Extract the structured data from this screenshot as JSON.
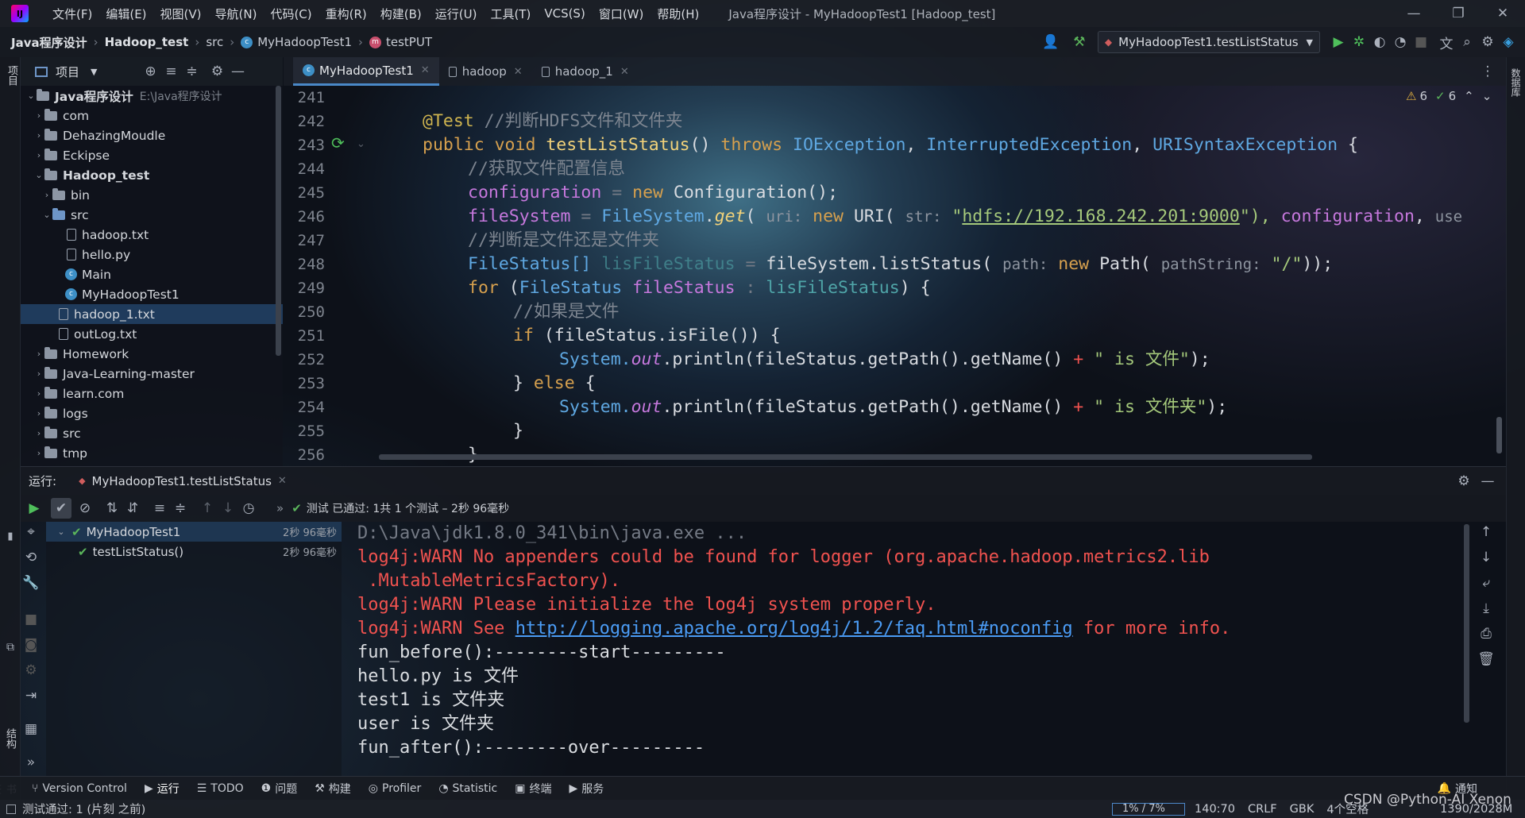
{
  "title_bar": {
    "menus": [
      "文件(F)",
      "编辑(E)",
      "视图(V)",
      "导航(N)",
      "代码(C)",
      "重构(R)",
      "构建(B)",
      "运行(U)",
      "工具(T)",
      "VCS(S)",
      "窗口(W)",
      "帮助(H)"
    ],
    "window_title": "Java程序设计 - MyHadoopTest1 [Hadoop_test]"
  },
  "breadcrumb": {
    "items": [
      "Java程序设计",
      "Hadoop_test",
      "src",
      "MyHadoopTest1",
      "testPUT"
    ]
  },
  "run_config": "MyHadoopTest1.testListStatus",
  "project_panel": {
    "title": "项目",
    "tree": [
      {
        "label": "Java程序设计",
        "path": "E:\\Java程序设计",
        "kind": "root"
      },
      {
        "label": "com",
        "kind": "folder"
      },
      {
        "label": "DehazingMoudle",
        "kind": "folder"
      },
      {
        "label": "Eckipse",
        "kind": "folder"
      },
      {
        "label": "Hadoop_test",
        "kind": "folder"
      },
      {
        "label": "bin",
        "kind": "folder"
      },
      {
        "label": "src",
        "kind": "folder"
      },
      {
        "label": "hadoop.txt",
        "kind": "file"
      },
      {
        "label": "hello.py",
        "kind": "file"
      },
      {
        "label": "Main",
        "kind": "class"
      },
      {
        "label": "MyHadoopTest1",
        "kind": "class"
      },
      {
        "label": "hadoop_1.txt",
        "kind": "file"
      },
      {
        "label": "outLog.txt",
        "kind": "file"
      },
      {
        "label": "Homework",
        "kind": "folder"
      },
      {
        "label": "Java-Learning-master",
        "kind": "folder"
      },
      {
        "label": "learn.com",
        "kind": "folder"
      },
      {
        "label": "logs",
        "kind": "folder"
      },
      {
        "label": "src",
        "kind": "folder"
      },
      {
        "label": "tmp",
        "kind": "folder"
      }
    ]
  },
  "editor": {
    "tabs": [
      {
        "label": "MyHadoopTest1",
        "active": true
      },
      {
        "label": "hadoop",
        "active": false
      },
      {
        "label": "hadoop_1",
        "active": false
      }
    ],
    "warnings": "6",
    "checks": "6",
    "line_numbers": [
      "241",
      "242",
      "243",
      "244",
      "245",
      "246",
      "247",
      "248",
      "249",
      "250",
      "251",
      "252",
      "253",
      "254",
      "255",
      "256"
    ],
    "code": {
      "l242a": "@Test",
      "l242b": " //判断HDFS文件和文件夹",
      "l243a": "public void ",
      "l243b": "testListStatus",
      "l243c": "() ",
      "l243d": "throws ",
      "l243e": "IOException",
      "l243f": ", ",
      "l243g": "InterruptedException",
      "l243h": ", ",
      "l243i": "URISyntaxException",
      "l243j": " {",
      "l244": "//获取文件配置信息",
      "l245a": "configuration",
      "l245b": " = ",
      "l245c": "new ",
      "l245d": "Configuration();",
      "l246a": "fileSystem",
      "l246b": " = ",
      "l246c": "FileSystem",
      "l246d": ".",
      "l246e": "get",
      "l246f": "( ",
      "l246g": "uri:",
      "l246h": " new ",
      "l246i": "URI",
      "l246j": "( ",
      "l246k": "str:",
      "l246l": " \"",
      "l246m": "hdfs://192.168.242.201:9000",
      "l246n": "\"), ",
      "l246o": "configuration",
      ", l246p": "",
      "l246q": ", ",
      "l246r": "use",
      "l247": "//判断是文件还是文件夹",
      "l248a": "FileStatus[]",
      "l248b": " lisFileStatus",
      "l248c": " = ",
      "l248d": "fileSystem.listStatus( ",
      "l248e": "path:",
      "l248f": " new ",
      "l248g": "Path( ",
      "l248h": "pathString:",
      "l248i": " \"/\"",
      "l248j": "));",
      "l249a": "for ",
      "l249b": "(",
      "l249c": "FileStatus ",
      "l249d": "fileStatus",
      " l249e": "",
      "l249f": " : ",
      "l249g": "lisFileStatus",
      "l249h": ") {",
      "l250": "//如果是文件",
      "l251a": "if ",
      "l251b": "(fileStatus.isFile()) {",
      "l252a": "System.",
      "l252b": "out",
      ".l252c": "",
      "l252d": ".println(fileStatus.getPath().getName() ",
      "l252e": "+ ",
      "l252f": "\" is 文件\"",
      "l252g": ");",
      "l253a": "} ",
      "l253b": "else",
      " l253c": "",
      "l253d": " {",
      "l254a": "System.",
      "l254b": "out",
      "l254d": ".println(fileStatus.getPath().getName() ",
      "l254e": "+ ",
      "l254f": "\" is 文件夹\"",
      "l254g": ");",
      "l255": "}",
      "l256": "}"
    }
  },
  "run_panel": {
    "label": "运行:",
    "config_tab": "MyHadoopTest1.testListStatus",
    "status": "测试 已通过: 1共 1 个测试 – 2秒 96毫秒",
    "tree": [
      {
        "label": "MyHadoopTest1",
        "time": "2秒 96毫秒"
      },
      {
        "label": "testListStatus()",
        "time": "2秒 96毫秒"
      }
    ],
    "console": [
      {
        "text": "D:\\Java\\jdk1.8.0_341\\bin\\java.exe ...",
        "color": "gray"
      },
      {
        "text": "log4j:WARN No appenders could be found for logger (org.apache.hadoop.metrics2.lib",
        "color": "red"
      },
      {
        "text": " .MutableMetricsFactory).",
        "color": "red"
      },
      {
        "text": "log4j:WARN Please initialize the log4j system properly.",
        "color": "red"
      },
      {
        "text": "log4j:WARN See ",
        "color": "red",
        "link": "http://logging.apache.org/log4j/1.2/faq.html#noconfig",
        "tail": " for more info."
      },
      {
        "text": "fun_before():--------start---------",
        "color": "white"
      },
      {
        "text": "hello.py is 文件",
        "color": "white"
      },
      {
        "text": "test1 is 文件夹",
        "color": "white"
      },
      {
        "text": "user is 文件夹",
        "color": "white"
      },
      {
        "text": "fun_after():--------over---------",
        "color": "white"
      }
    ]
  },
  "bottom_tools": [
    "Version Control",
    "运行",
    "TODO",
    "问题",
    "构建",
    "Profiler",
    "Statistic",
    "终端",
    "服务"
  ],
  "notifications": "通知",
  "status_bar": {
    "left": "测试通过: 1 (片刻 之前)",
    "progress": "1% / 7%",
    "position": "140:70",
    "line_ending": "CRLF",
    "encoding": "GBK",
    "indent": "4个空格",
    "memory": "1390/2028M",
    "watermark": "CSDN @Python-AI Xenon"
  },
  "left_strip_labels": [
    "项目",
    "结构",
    "书签"
  ],
  "right_strip_labels": [
    "数据库"
  ]
}
